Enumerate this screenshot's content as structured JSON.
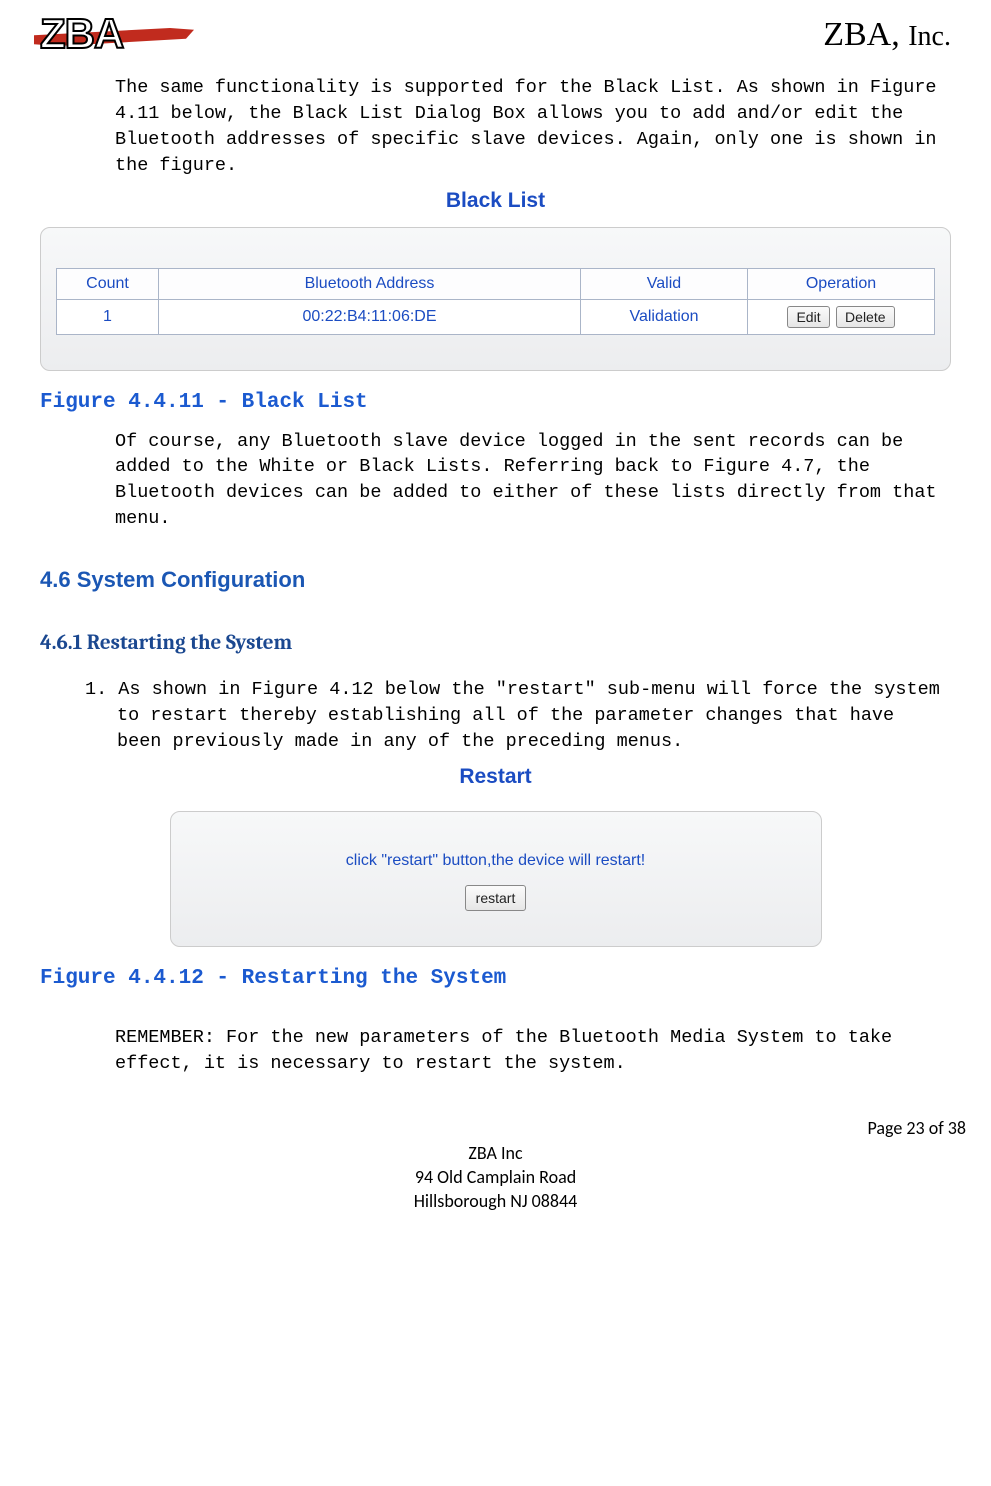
{
  "company": {
    "logo_text": "ZBA",
    "name_html": "ZBA, ",
    "inc": "Inc."
  },
  "para1": "The same functionality is supported for the Black List.  As shown in Figure 4.11 below, the Black List Dialog Box allows you to add and/or edit the Bluetooth addresses of specific slave devices. Again, only one is shown in the figure.",
  "blacklist": {
    "title": "Black List",
    "headers": [
      "Count",
      "Bluetooth Address",
      "Valid",
      "Operation"
    ],
    "row": {
      "count": "1",
      "addr": "00:22:B4:11:06:DE",
      "valid": "Validation",
      "edit": "Edit",
      "delete": "Delete"
    }
  },
  "figcap1": "Figure 4.4.11 - Black List",
  "para2": "Of course, any Bluetooth slave device logged in the sent records can be added to the White or Black Lists.  Referring back to Figure 4.7, the Bluetooth devices can be added to either of these lists directly from that menu.",
  "sec46": "4.6   System Configuration",
  "sec461": "4.6.1    Restarting the System",
  "numbered1": "1. As shown in Figure 4.12 below the \"restart\" sub-menu will force the system to restart thereby establishing all of the parameter changes that have been previously made in any of the preceding menus.",
  "restart": {
    "title": "Restart",
    "text": "click \"restart\" button,the device will restart!",
    "button": "restart"
  },
  "figcap2": "Figure 4.4.12  -  Restarting the System",
  "para3": "REMEMBER: For the new parameters of the Bluetooth Media System to take effect, it is necessary to restart the system.",
  "page_num": "Page 23 of 38",
  "footer": {
    "l1": "ZBA Inc",
    "l2": "94 Old Camplain Road",
    "l3": "Hillsborough NJ 08844"
  }
}
